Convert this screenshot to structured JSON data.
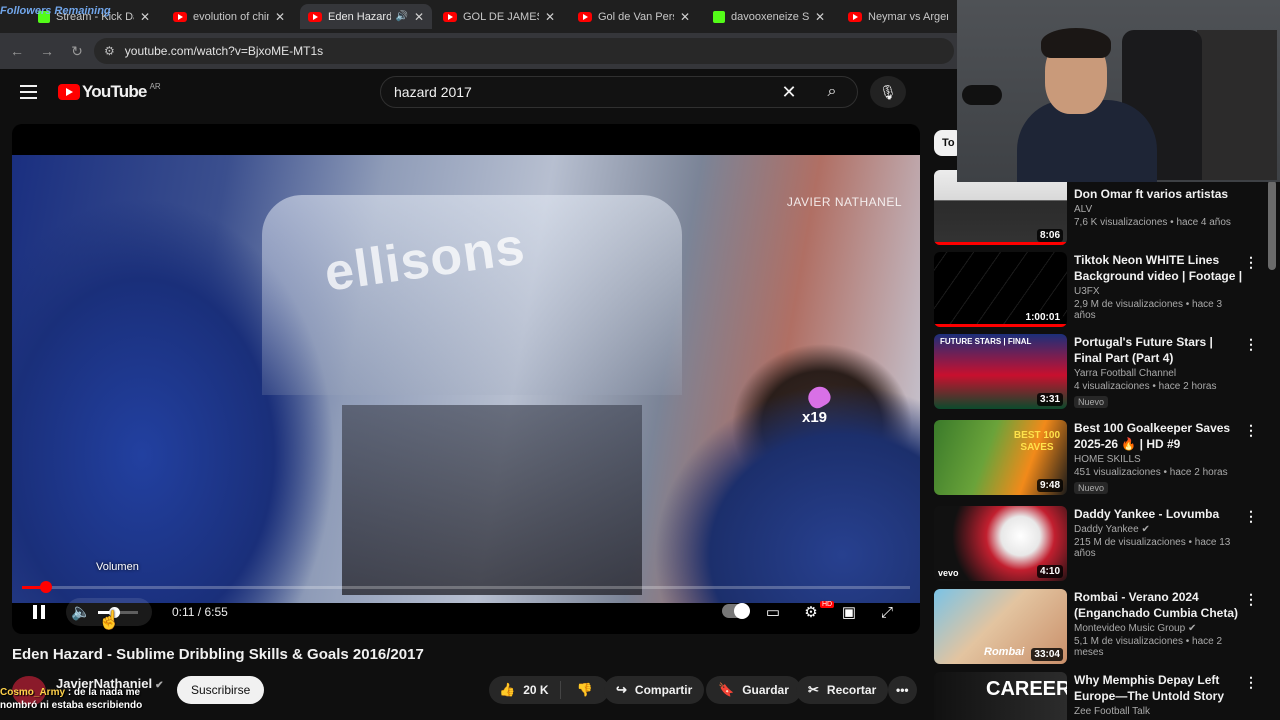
{
  "browser": {
    "stream_overlay": "Followers Remaining",
    "tabs": [
      {
        "title": "Stream - Kick Das",
        "favicon": "kick",
        "active": false
      },
      {
        "title": "evolution of chimp",
        "favicon": "youtube",
        "active": false
      },
      {
        "title": "Eden Hazard -",
        "favicon": "youtube",
        "active": true,
        "audio": true
      },
      {
        "title": "GOL DE JAMES RO",
        "favicon": "youtube",
        "active": false
      },
      {
        "title": "Gol de Van Persie",
        "favicon": "youtube",
        "active": false
      },
      {
        "title": "davooxeneize Stre",
        "favicon": "kick",
        "active": false
      },
      {
        "title": "Neymar vs Argent",
        "favicon": "youtube",
        "active": false
      }
    ],
    "url": "youtube.com/watch?v=BjxoME-MT1s"
  },
  "youtube": {
    "logo_text": "YouTube",
    "country_code": "AR",
    "search_query": "hazard 2017"
  },
  "player": {
    "watermark": "JAVIER NATHANEL",
    "video_brand": "ellisons",
    "badge": "x19",
    "volume_tooltip": "Volumen",
    "time": "0:11 / 6:55",
    "progress": 0.027,
    "volume_level": 0.4
  },
  "video": {
    "title": "Eden Hazard - Sublime Dribbling Skills & Goals 2016/2017",
    "channel": "JavierNathaniel",
    "subscribe_label": "Suscribirse",
    "likes": "20 K",
    "share_label": "Compartir",
    "save_label": "Guardar",
    "clip_label": "Recortar"
  },
  "chat_overlay": {
    "user": "Cosmo_Army",
    "message": ": de la nada me",
    "line2": "nombró ni estaba escribiendo"
  },
  "sidebar": {
    "chip_label": "To",
    "recommendations": [
      {
        "title": "Don Omar ft varios artistas",
        "channel": "ALV",
        "meta": "7,6 K visualizaciones • hace 4 años",
        "duration": "8:06",
        "new": false
      },
      {
        "title": "Tiktok Neon WHITE Lines Background video | Footage | ...",
        "channel": "U3FX",
        "meta": "2,9 M de visualizaciones • hace 3 años",
        "duration": "1:00:01",
        "new": false
      },
      {
        "title": "Portugal's Future Stars | Final Part (Part 4)",
        "channel": "Yarra Football Channel",
        "meta": "4 visualizaciones • hace 2 horas",
        "duration": "3:31",
        "new": true,
        "thumb_text": "FUTURE STARS | FINAL"
      },
      {
        "title": "Best 100 Goalkeeper Saves 2025-26 🔥 | HD #9",
        "channel": "HOME SKILLS",
        "meta": "451 visualizaciones • hace 2 horas",
        "duration": "9:48",
        "new": true,
        "thumb_text": "BEST 100 SAVES"
      },
      {
        "title": "Daddy Yankee - Lovumba",
        "channel": "Daddy Yankee",
        "meta": "215 M de visualizaciones • hace 13 años",
        "duration": "4:10",
        "new": false,
        "thumb_text": "vevo"
      },
      {
        "title": "Rombai - Verano 2024 (Enganchado Cumbia Cheta)",
        "channel": "Montevideo Music Group",
        "meta": "5,1 M de visualizaciones • hace 2 meses",
        "duration": "33:04",
        "new": false,
        "thumb_text": "Rombai"
      },
      {
        "title": "Why Memphis Depay Left Europe—The Untold Story",
        "channel": "Zee Football Talk",
        "meta": "",
        "duration": "",
        "new": false,
        "thumb_text": "CAREER"
      }
    ],
    "new_badge": "Nuevo"
  }
}
